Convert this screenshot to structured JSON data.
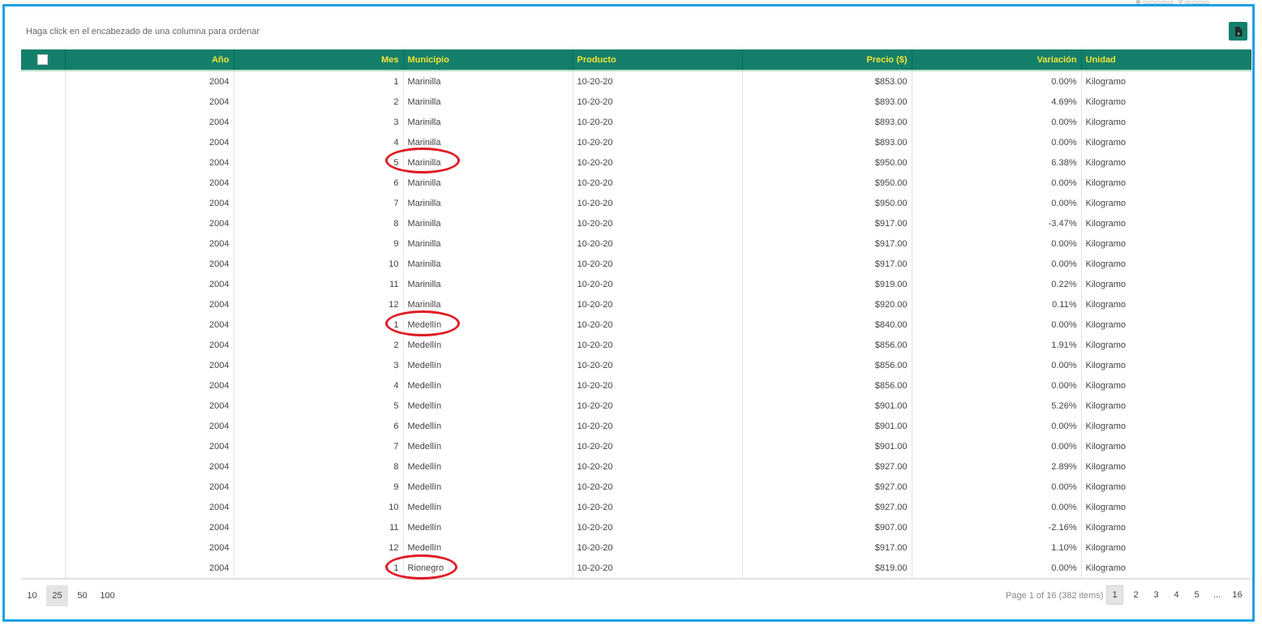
{
  "toolbar": {
    "hint": "Haga click en el encabezado de una columna para ordenar",
    "export_icon": "excel-export-icon"
  },
  "columns": {
    "year": "Año",
    "month": "Mes",
    "municipio": "Municipio",
    "producto": "Producto",
    "precio": "Precio ($)",
    "variacion": "Variación",
    "unidad": "Unidad"
  },
  "rows": [
    [
      "2004",
      "1",
      "Marinilla",
      "10-20-20",
      "$853.00",
      "0.00%",
      "Kilogramo"
    ],
    [
      "2004",
      "2",
      "Marinilla",
      "10-20-20",
      "$893.00",
      "4.69%",
      "Kilogramo"
    ],
    [
      "2004",
      "3",
      "Marinilla",
      "10-20-20",
      "$893.00",
      "0.00%",
      "Kilogramo"
    ],
    [
      "2004",
      "4",
      "Marinilla",
      "10-20-20",
      "$893.00",
      "0.00%",
      "Kilogramo"
    ],
    [
      "2004",
      "5",
      "Marinilla",
      "10-20-20",
      "$950.00",
      "6.38%",
      "Kilogramo"
    ],
    [
      "2004",
      "6",
      "Marinilla",
      "10-20-20",
      "$950.00",
      "0.00%",
      "Kilogramo"
    ],
    [
      "2004",
      "7",
      "Marinilla",
      "10-20-20",
      "$950.00",
      "0.00%",
      "Kilogramo"
    ],
    [
      "2004",
      "8",
      "Marinilla",
      "10-20-20",
      "$917.00",
      "-3.47%",
      "Kilogramo"
    ],
    [
      "2004",
      "9",
      "Marinilla",
      "10-20-20",
      "$917.00",
      "0.00%",
      "Kilogramo"
    ],
    [
      "2004",
      "10",
      "Marinilla",
      "10-20-20",
      "$917.00",
      "0.00%",
      "Kilogramo"
    ],
    [
      "2004",
      "11",
      "Marinilla",
      "10-20-20",
      "$919.00",
      "0.22%",
      "Kilogramo"
    ],
    [
      "2004",
      "12",
      "Marinilla",
      "10-20-20",
      "$920.00",
      "0.11%",
      "Kilogramo"
    ],
    [
      "2004",
      "1",
      "Medellín",
      "10-20-20",
      "$840.00",
      "0.00%",
      "Kilogramo"
    ],
    [
      "2004",
      "2",
      "Medellín",
      "10-20-20",
      "$856.00",
      "1.91%",
      "Kilogramo"
    ],
    [
      "2004",
      "3",
      "Medellín",
      "10-20-20",
      "$856.00",
      "0.00%",
      "Kilogramo"
    ],
    [
      "2004",
      "4",
      "Medellín",
      "10-20-20",
      "$856.00",
      "0.00%",
      "Kilogramo"
    ],
    [
      "2004",
      "5",
      "Medellín",
      "10-20-20",
      "$901.00",
      "5.26%",
      "Kilogramo"
    ],
    [
      "2004",
      "6",
      "Medellín",
      "10-20-20",
      "$901.00",
      "0.00%",
      "Kilogramo"
    ],
    [
      "2004",
      "7",
      "Medellín",
      "10-20-20",
      "$901.00",
      "0.00%",
      "Kilogramo"
    ],
    [
      "2004",
      "8",
      "Medellín",
      "10-20-20",
      "$927.00",
      "2.89%",
      "Kilogramo"
    ],
    [
      "2004",
      "9",
      "Medellín",
      "10-20-20",
      "$927.00",
      "0.00%",
      "Kilogramo"
    ],
    [
      "2004",
      "10",
      "Medellín",
      "10-20-20",
      "$927.00",
      "0.00%",
      "Kilogramo"
    ],
    [
      "2004",
      "11",
      "Medellín",
      "10-20-20",
      "$907.00",
      "-2.16%",
      "Kilogramo"
    ],
    [
      "2004",
      "12",
      "Medellín",
      "10-20-20",
      "$917.00",
      "1.10%",
      "Kilogramo"
    ],
    [
      "2004",
      "1",
      "Rionegro",
      "10-20-20",
      "$819.00",
      "0.00%",
      "Kilogramo"
    ]
  ],
  "pager": {
    "sizes": [
      "10",
      "25",
      "50",
      "100"
    ],
    "active_size": "25",
    "info": "Page 1 of 16 (382 items)",
    "pages": [
      "1",
      "2",
      "3",
      "4",
      "5",
      "...",
      "16"
    ],
    "active_page": "1"
  },
  "colors": {
    "header_bg": "#137f6b",
    "header_text": "#f4e235",
    "frame_border": "#1aa0e6",
    "annotation": "#e01b24"
  }
}
